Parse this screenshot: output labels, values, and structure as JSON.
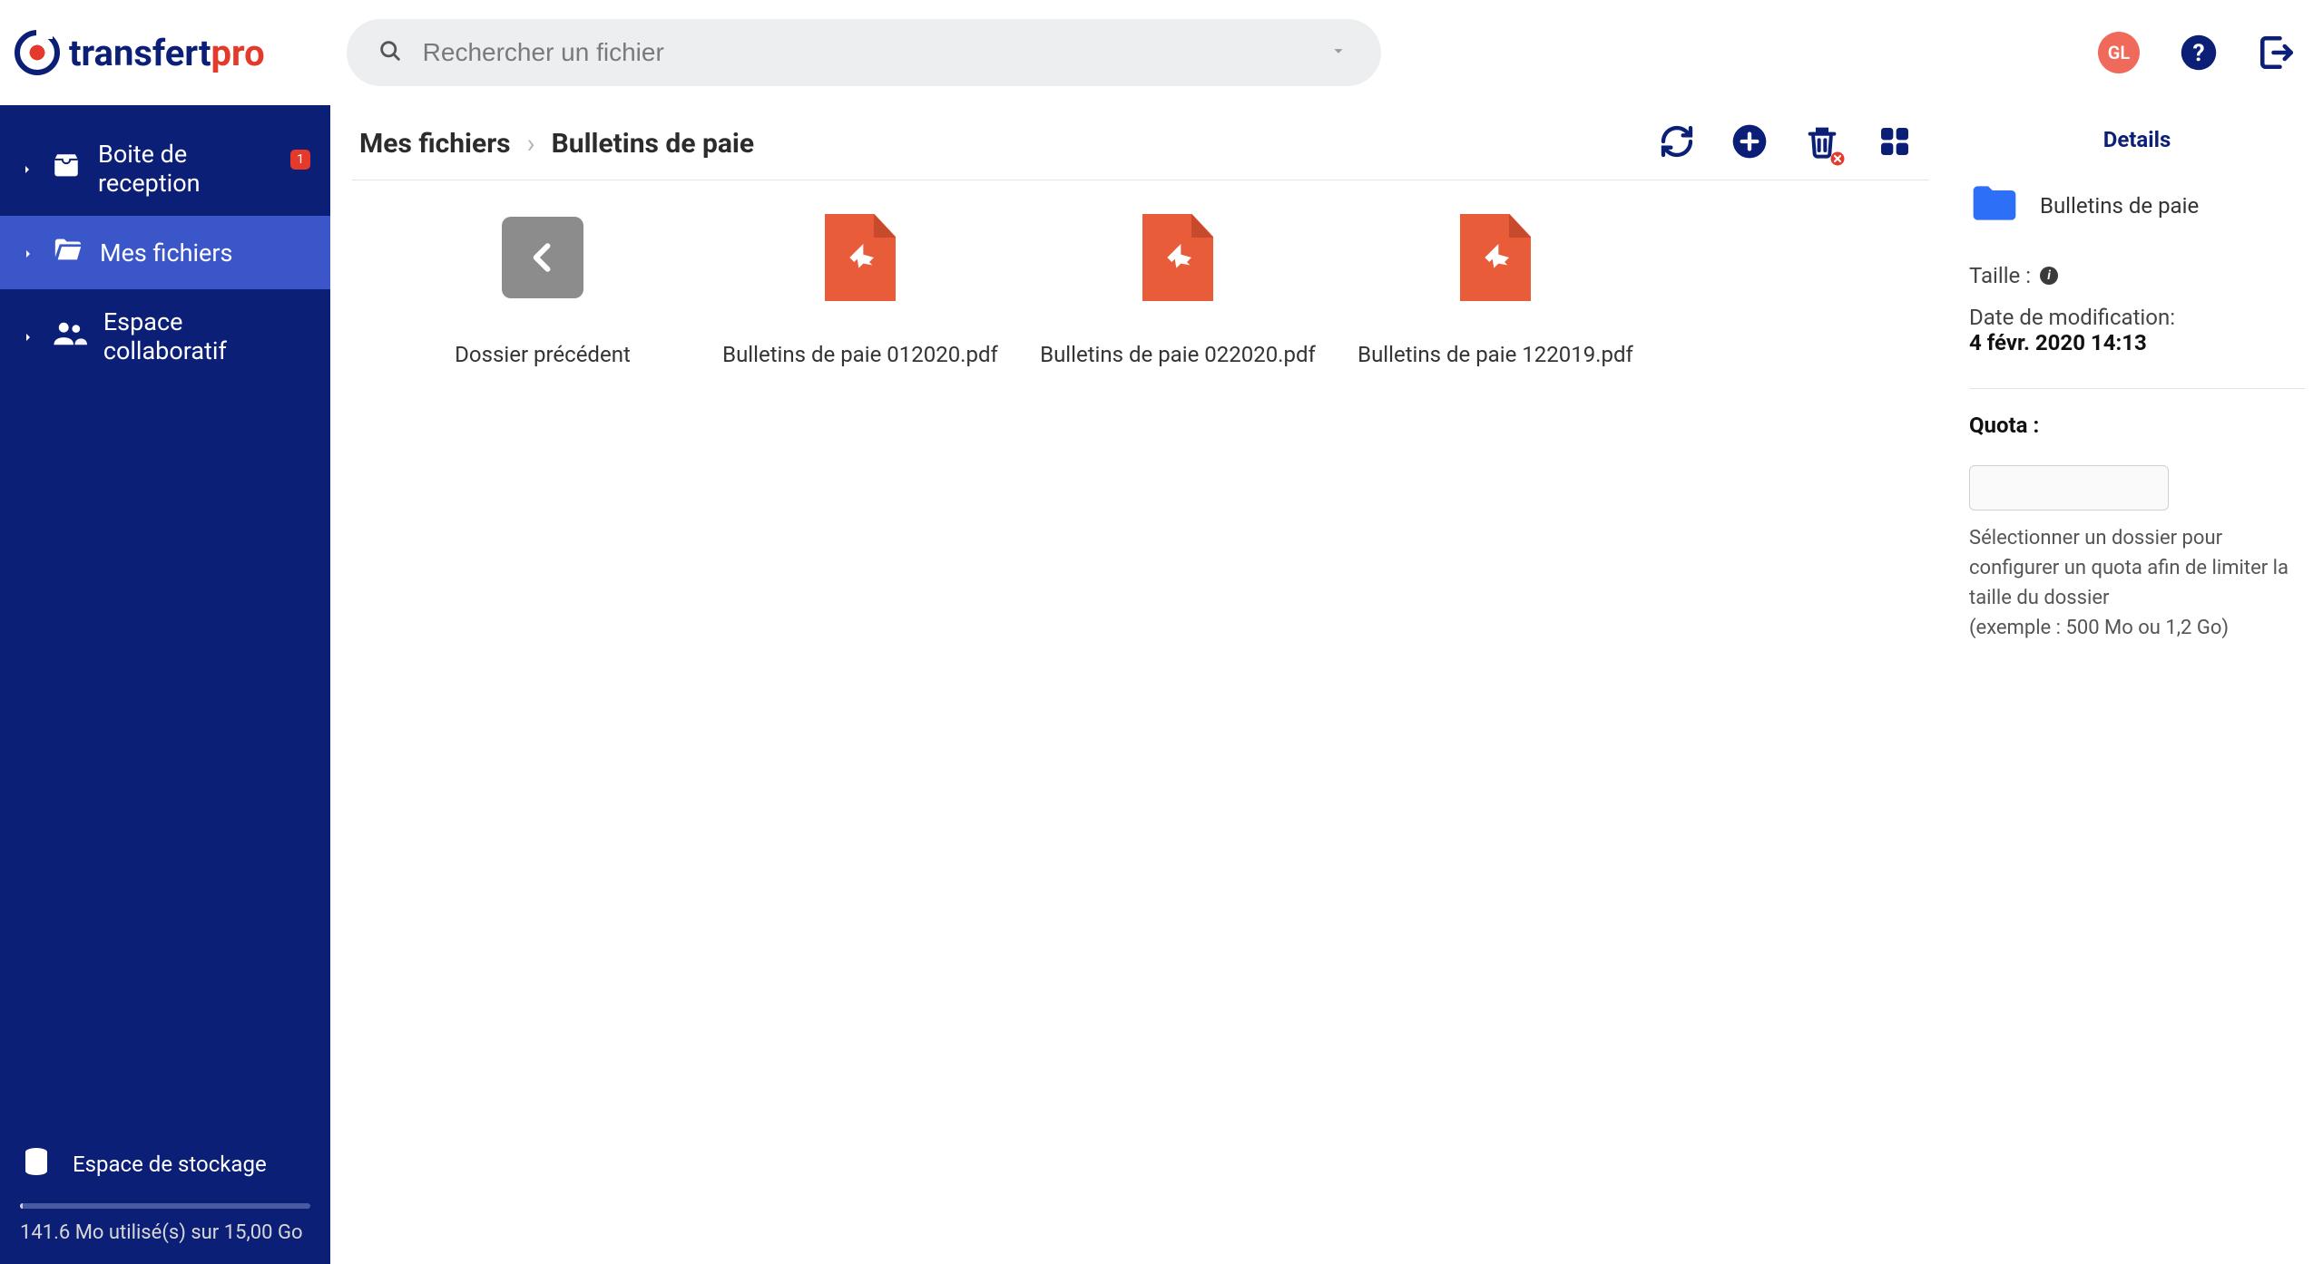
{
  "brand": {
    "part1": "transfert",
    "part2": "pro"
  },
  "search": {
    "placeholder": "Rechercher un fichier"
  },
  "avatar": {
    "initials": "GL"
  },
  "sidebar": {
    "items": [
      {
        "label": "Boite de reception",
        "badge": "1"
      },
      {
        "label": "Mes fichiers"
      },
      {
        "label": "Espace collaboratif"
      }
    ],
    "storage": {
      "label": "Espace de stockage",
      "text": "141.6 Mo utilisé(s) sur 15,00 Go"
    }
  },
  "breadcrumb": {
    "root": "Mes fichiers",
    "current": "Bulletins de paie"
  },
  "files": {
    "back_label": "Dossier précédent",
    "items": [
      {
        "name": "Bulletins de paie 012020.pdf"
      },
      {
        "name": "Bulletins de paie 022020.pdf"
      },
      {
        "name": "Bulletins de paie 122019.pdf"
      }
    ]
  },
  "details": {
    "title": "Details",
    "folder_name": "Bulletins de paie",
    "size_label": "Taille :",
    "modified_label": "Date de modification:",
    "modified_value": "4 févr. 2020 14:13",
    "quota_label": "Quota :",
    "quota_help": "Sélectionner un dossier pour configurer un quota afin de limiter la taille du dossier",
    "quota_example": "(exemple : 500 Mo ou 1,2 Go)"
  }
}
